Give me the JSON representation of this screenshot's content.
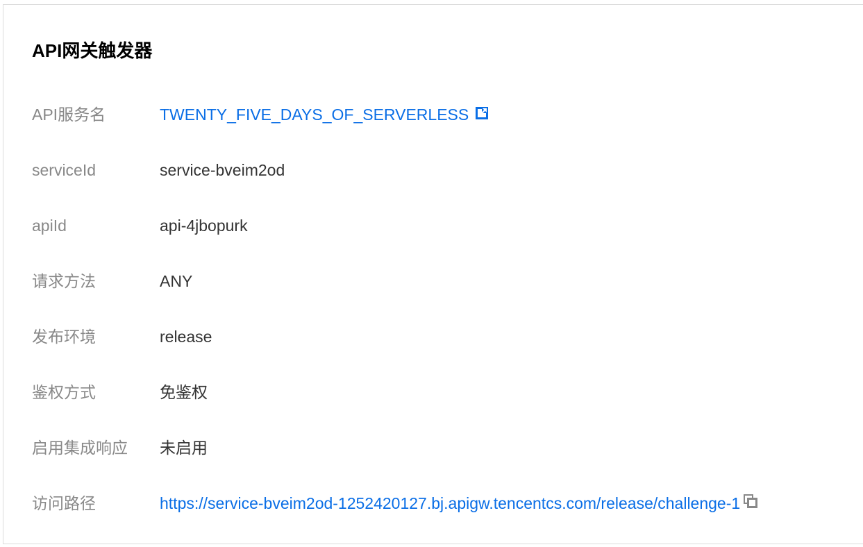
{
  "section": {
    "title": "API网关触发器"
  },
  "fields": [
    {
      "label": "API服务名",
      "value": "TWENTY_FIVE_DAYS_OF_SERVERLESS",
      "kind": "link",
      "icon": "external-link-icon"
    },
    {
      "label": "serviceId",
      "value": "service-bveim2od",
      "kind": "text"
    },
    {
      "label": "apiId",
      "value": "api-4jbopurk",
      "kind": "text"
    },
    {
      "label": "请求方法",
      "value": "ANY",
      "kind": "text"
    },
    {
      "label": "发布环境",
      "value": "release",
      "kind": "text"
    },
    {
      "label": "鉴权方式",
      "value": "免鉴权",
      "kind": "text"
    },
    {
      "label": "启用集成响应",
      "value": "未启用",
      "kind": "text"
    },
    {
      "label": "访问路径",
      "value": "https://service-bveim2od-1252420127.bj.apigw.tencentcs.com/release/challenge-1",
      "kind": "link",
      "icon": "copy-icon"
    }
  ],
  "colors": {
    "label": "#888888",
    "value": "#333333",
    "link": "#0a6ee6",
    "icon_gray": "#888888",
    "border": "#dcdcdc"
  }
}
